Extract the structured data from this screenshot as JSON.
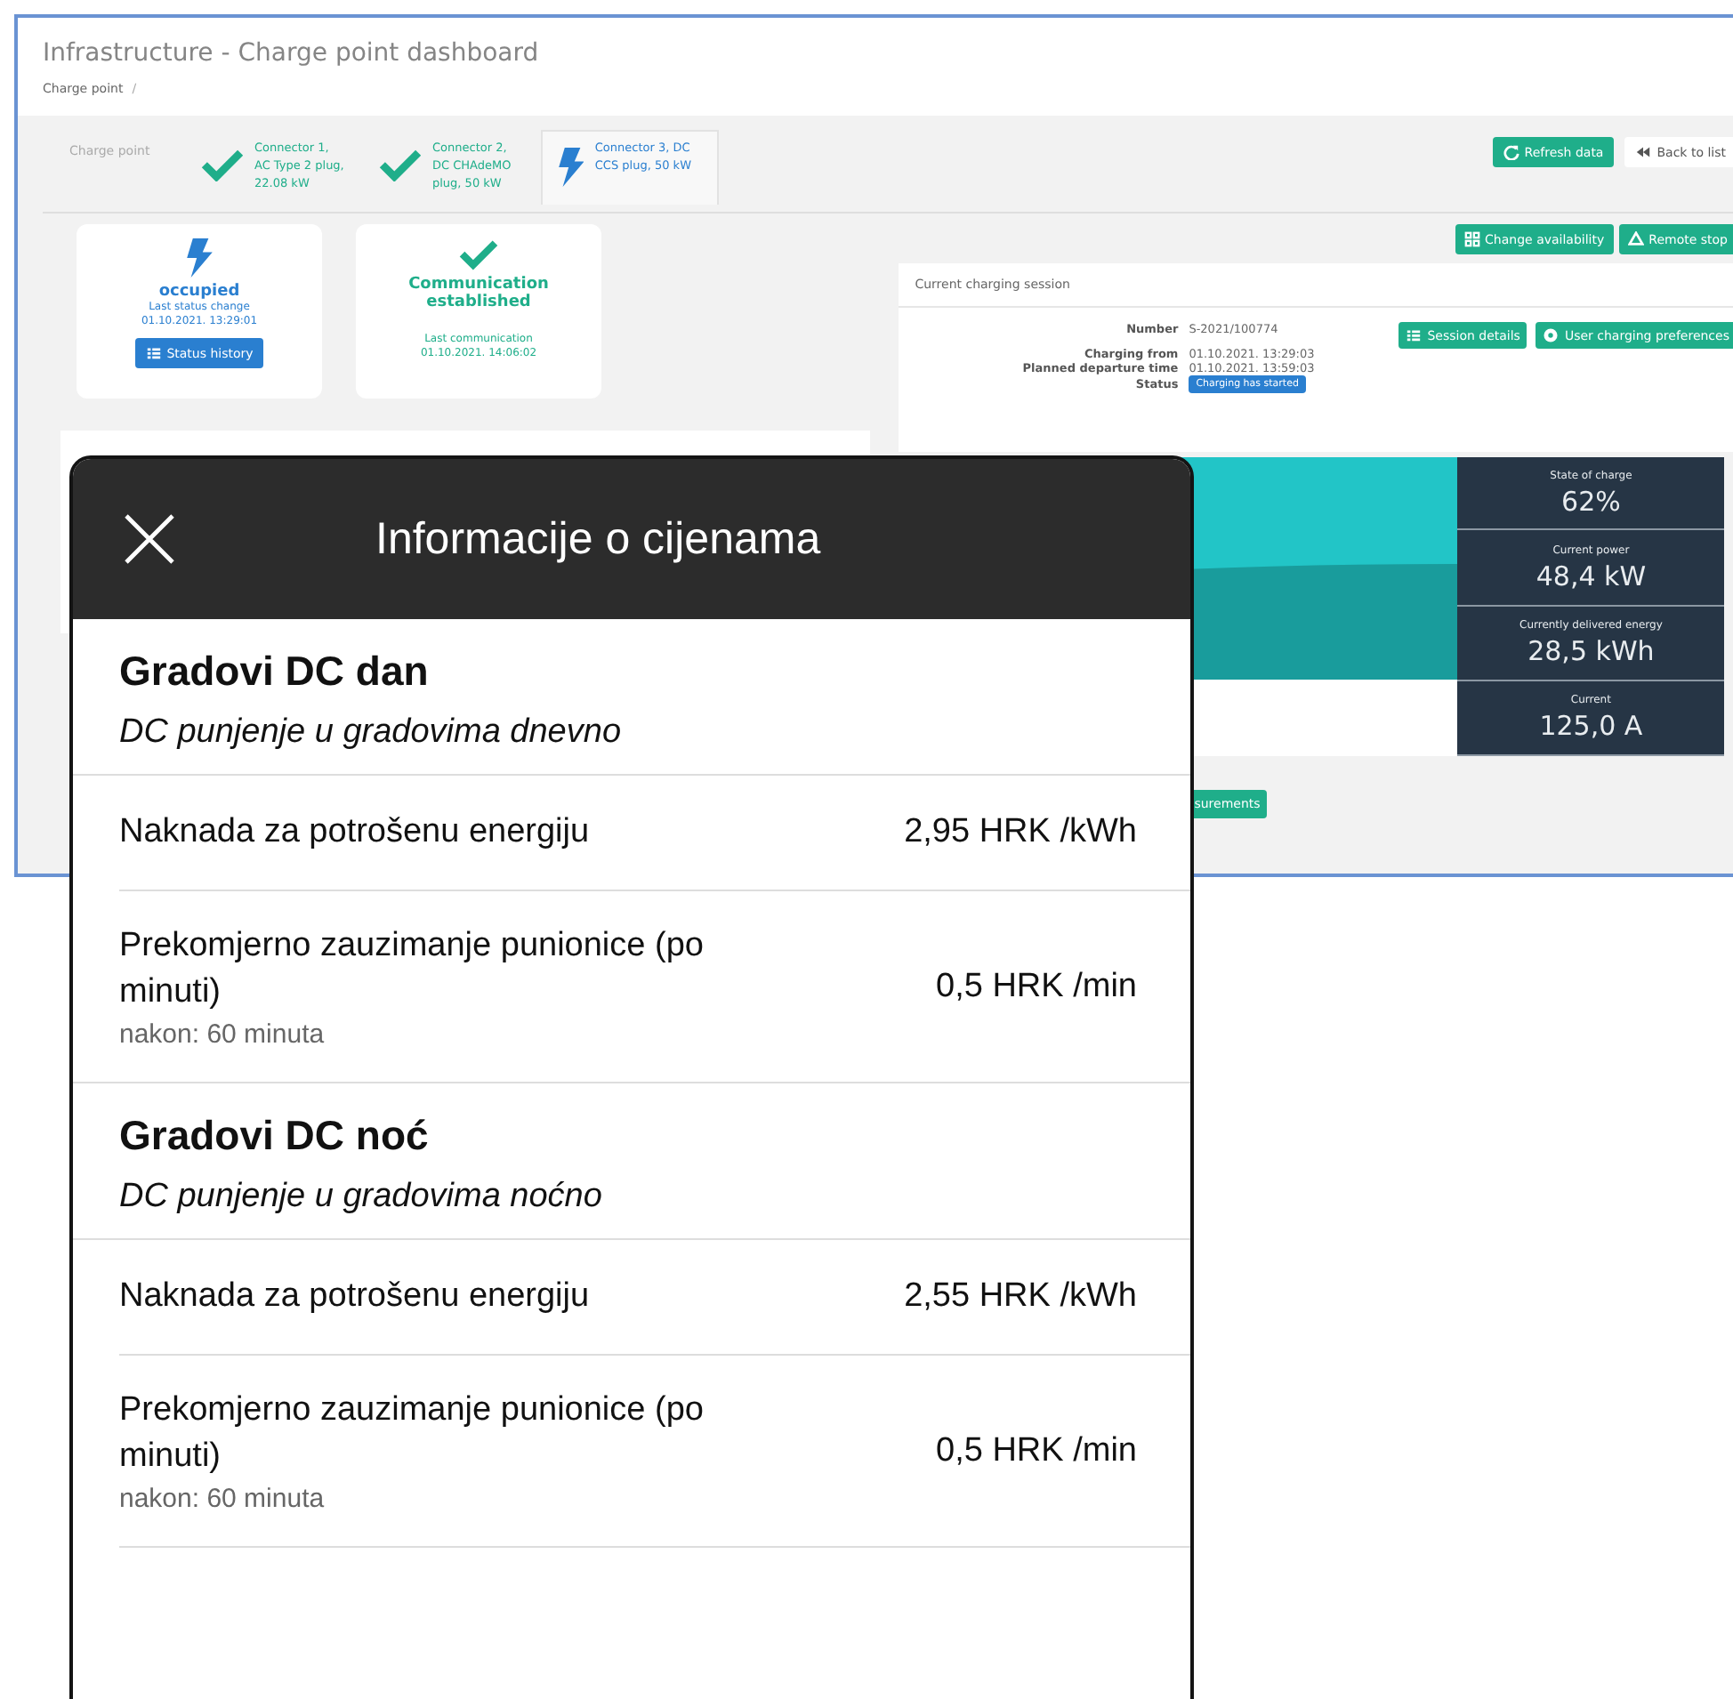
{
  "page": {
    "title": "Infrastructure - Charge point dashboard",
    "breadcrumb": "Charge point",
    "breadcrumb_separator": "/"
  },
  "tabs": [
    {
      "kind": "point",
      "label": "Charge point",
      "selected": false
    },
    {
      "kind": "available",
      "label": "Connector 1, AC Type 2 plug, 22.08 kW",
      "selected": false
    },
    {
      "kind": "available",
      "label": "Connector 2, DC CHAdeMO plug, 50 kW",
      "selected": false
    },
    {
      "kind": "occupied",
      "label": "Connector 3, DC CCS plug, 50 kW",
      "selected": true
    }
  ],
  "toolbar": [
    {
      "label": "Refresh data",
      "kind": "primary"
    },
    {
      "label": "Back to list",
      "kind": "default"
    }
  ],
  "status_cards": [
    {
      "kind": "occupied",
      "title": "occupied",
      "label": "Last status change",
      "time": "01.10.2021. 13:29:01",
      "button": {
        "label": "Status history"
      }
    },
    {
      "kind": "communication",
      "title": "Communication established",
      "label": "Last communication",
      "time": "01.10.2021. 14:06:02"
    }
  ],
  "actions": [
    {
      "label": "Change availability"
    },
    {
      "label": "Remote stop"
    }
  ],
  "session": {
    "title": "Current charging session",
    "fields": [
      {
        "kind": "text",
        "label": "Number",
        "value": "S-2021/100774"
      },
      {
        "kind": "text",
        "label": "Charging from",
        "value": "01.10.2021. 13:29:03"
      },
      {
        "kind": "text",
        "label": "Planned departure time",
        "value": "01.10.2021. 13:59:03"
      },
      {
        "kind": "badge",
        "label": "Status",
        "value": "Charging has started"
      }
    ],
    "buttons": [
      {
        "label": "Session details"
      },
      {
        "label": "User charging preferences"
      }
    ]
  },
  "stats": [
    {
      "label": "State of charge",
      "value": "62%"
    },
    {
      "label": "Current power",
      "value": "48,4 kW"
    },
    {
      "label": "Currently delivered energy",
      "value": "28,5 kWh"
    },
    {
      "label": "Current",
      "value": "125,0 A"
    }
  ],
  "measurements_button": "surements",
  "modal": {
    "title": "Informacije o cijenama",
    "sections": [
      {
        "name": "Gradovi DC dan",
        "description": "DC punjenje u gradovima dnevno",
        "fees": [
          {
            "label": "Naknada za potrošenu energiju",
            "price": "2,95 HRK /kWh"
          },
          {
            "label": "Prekomjerno zauzimanje punionice (po minuti)",
            "note": "nakon: 60 minuta",
            "price": "0,5 HRK /min"
          }
        ]
      },
      {
        "name": "Gradovi DC noć",
        "description": "DC punjenje u gradovima noćno",
        "fees": [
          {
            "label": "Naknada za potrošenu energiju",
            "price": "2,55 HRK /kWh"
          },
          {
            "label": "Prekomjerno zauzimanje punionice (po minuti)",
            "note": "nakon: 60 minuta",
            "price": "0,5 HRK /min"
          }
        ]
      }
    ]
  }
}
